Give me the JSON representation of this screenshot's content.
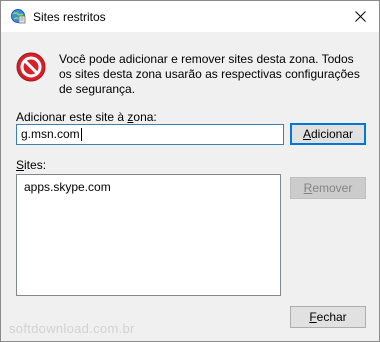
{
  "window": {
    "title": "Sites restritos",
    "close_symbol": "✕"
  },
  "info": {
    "icon": "restricted-zone-icon",
    "text": "Você pode adicionar e remover sites desta zona. Todos os sites desta zona usarão as respectivas configurações de segurança."
  },
  "add_field": {
    "label_mnemonic": "z",
    "label_before": "Adicionar este site à ",
    "label_after": "ona:",
    "value": "g.msn.com"
  },
  "buttons": {
    "add_mnemonic": "A",
    "add_rest": "dicionar",
    "remove_mnemonic": "R",
    "remove_rest": "emover",
    "close_mnemonic": "F",
    "close_rest": "echar"
  },
  "sites": {
    "label_mnemonic": "S",
    "label_rest": "ites:",
    "items": [
      "apps.skype.com"
    ]
  },
  "watermark": "softdownload.com.br",
  "colors": {
    "accent": "#0078d7",
    "restricted_red": "#d8202a"
  }
}
